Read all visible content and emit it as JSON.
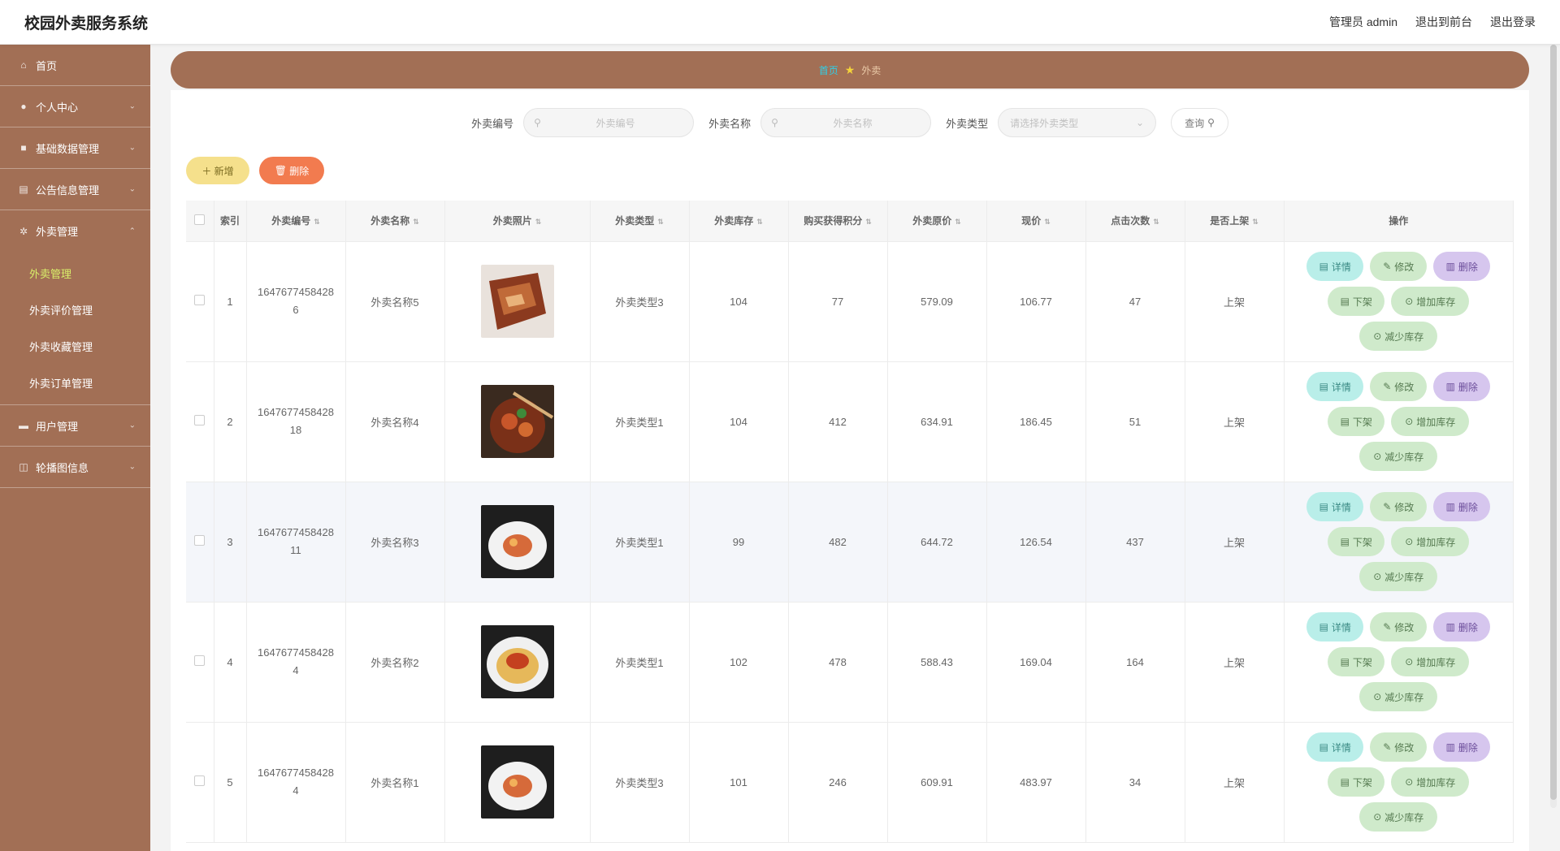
{
  "header": {
    "title": "校园外卖服务系统",
    "admin_label": "管理员 admin",
    "home_link": "退出到前台",
    "logout": "退出登录"
  },
  "sidebar": {
    "items": [
      {
        "label": "首页",
        "icon": "home-icon"
      },
      {
        "label": "个人中心",
        "icon": "user-icon"
      },
      {
        "label": "基础数据管理",
        "icon": "data-icon"
      },
      {
        "label": "公告信息管理",
        "icon": "notice-icon"
      },
      {
        "label": "外卖管理",
        "icon": "gear-icon"
      }
    ],
    "sub_items": [
      "外卖管理",
      "外卖评价管理",
      "外卖收藏管理",
      "外卖订单管理"
    ],
    "items_after": [
      {
        "label": "用户管理",
        "icon": "users-icon"
      },
      {
        "label": "轮播图信息",
        "icon": "image-icon"
      }
    ]
  },
  "breadcrumb": {
    "home": "首页",
    "current": "外卖"
  },
  "search": {
    "code_label": "外卖编号",
    "code_placeholder": "外卖编号",
    "name_label": "外卖名称",
    "name_placeholder": "外卖名称",
    "type_label": "外卖类型",
    "type_placeholder": "请选择外卖类型",
    "query_button": "查询"
  },
  "toolbar": {
    "add_label": "新增",
    "delete_label": "删除"
  },
  "table": {
    "headers": [
      "索引",
      "外卖编号",
      "外卖名称",
      "外卖照片",
      "外卖类型",
      "外卖库存",
      "购买获得积分",
      "外卖原价",
      "现价",
      "点击次数",
      "是否上架",
      "操作"
    ],
    "rows": [
      {
        "index": "1",
        "code_a": "1647677458428",
        "code_b": "6",
        "name": "外卖名称5",
        "type": "外卖类型3",
        "stock": "104",
        "points": "77",
        "original": "579.09",
        "price": "106.77",
        "clicks": "47",
        "status": "上架"
      },
      {
        "index": "2",
        "code_a": "1647677458428",
        "code_b": "18",
        "name": "外卖名称4",
        "type": "外卖类型1",
        "stock": "104",
        "points": "412",
        "original": "634.91",
        "price": "186.45",
        "clicks": "51",
        "status": "上架"
      },
      {
        "index": "3",
        "code_a": "1647677458428",
        "code_b": "11",
        "name": "外卖名称3",
        "type": "外卖类型1",
        "stock": "99",
        "points": "482",
        "original": "644.72",
        "price": "126.54",
        "clicks": "437",
        "status": "上架"
      },
      {
        "index": "4",
        "code_a": "1647677458428",
        "code_b": "4",
        "name": "外卖名称2",
        "type": "外卖类型1",
        "stock": "102",
        "points": "478",
        "original": "588.43",
        "price": "169.04",
        "clicks": "164",
        "status": "上架"
      },
      {
        "index": "5",
        "code_a": "1647677458428",
        "code_b": "4",
        "name": "外卖名称1",
        "type": "外卖类型3",
        "stock": "101",
        "points": "246",
        "original": "609.91",
        "price": "483.97",
        "clicks": "34",
        "status": "上架"
      }
    ],
    "ops": {
      "detail": "详情",
      "edit": "修改",
      "remove": "删除",
      "down": "下架",
      "add_stock": "增加库存",
      "sub_stock": "减少库存"
    }
  },
  "colors": {
    "sidebar": "#a26f55",
    "accent_sub": "#d9f06a",
    "add_btn": "#f5e08c",
    "del_btn": "#f27b4f"
  }
}
